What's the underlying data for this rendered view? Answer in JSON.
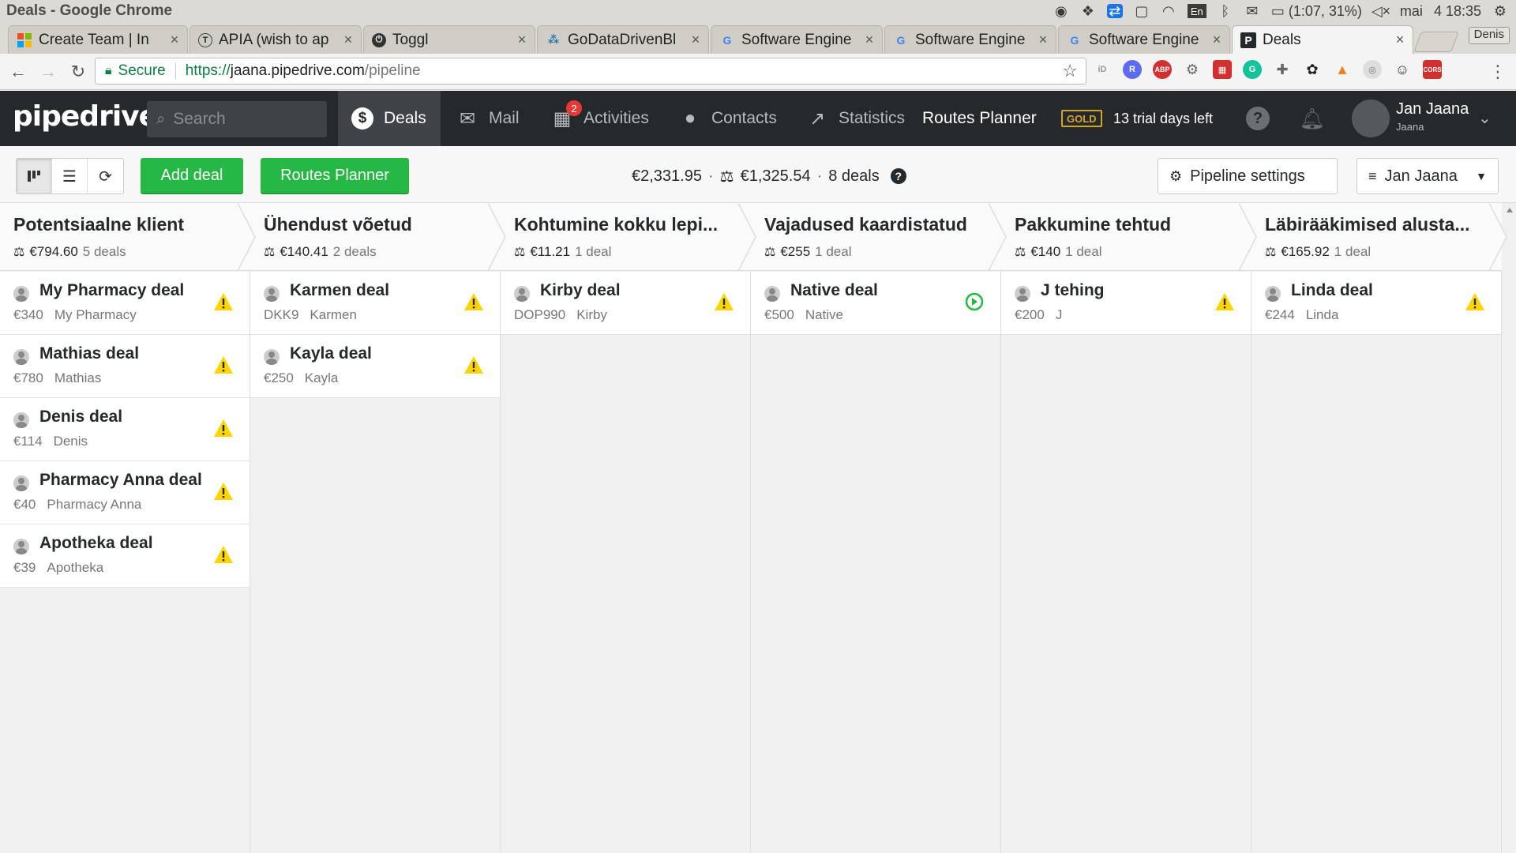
{
  "os": {
    "window_title": "Deals - Google Chrome",
    "battery": "(1:07, 31%)",
    "lang": "En",
    "day": "mai",
    "time": "4 18:35"
  },
  "browser": {
    "tabs": [
      {
        "label": "Create Team | In",
        "favicon": "microsoft"
      },
      {
        "label": "APIA (wish to ap",
        "favicon": "T"
      },
      {
        "label": "Toggl",
        "favicon": "toggl"
      },
      {
        "label": "GoDataDrivenBl",
        "favicon": "gdd"
      },
      {
        "label": "Software Engine",
        "favicon": "G"
      },
      {
        "label": "Software Engine",
        "favicon": "G"
      },
      {
        "label": "Software Engine",
        "favicon": "G"
      },
      {
        "label": "Deals",
        "favicon": "P"
      }
    ],
    "profile": "Denis",
    "secure_label": "Secure",
    "url_scheme": "https://",
    "url_host": "jaana.pipedrive.com",
    "url_path": "/pipeline"
  },
  "nav": {
    "logo": "pipedrive",
    "search_placeholder": "Search",
    "items": [
      {
        "label": "Deals"
      },
      {
        "label": "Mail"
      },
      {
        "label": "Activities",
        "badge": "2"
      },
      {
        "label": "Contacts"
      },
      {
        "label": "Statistics"
      },
      {
        "label": "Routes Planner"
      }
    ],
    "gold": "GOLD",
    "trial": "13 trial days left",
    "user_name": "Jan Jaana",
    "user_sub": "Jaana"
  },
  "toolbar": {
    "add_deal": "Add deal",
    "routes_planner": "Routes Planner",
    "total": "€2,331.95",
    "weighted": "€1,325.54",
    "deals_count": "8 deals",
    "pipeline_settings": "Pipeline settings",
    "filter_user": "Jan Jaana"
  },
  "stages": [
    {
      "title": "Potentsiaalne klient",
      "value": "€794.60",
      "count": "5 deals",
      "deals": [
        {
          "title": "My Pharmacy deal",
          "value": "€340",
          "org": "My Pharmacy",
          "status": "warning"
        },
        {
          "title": "Mathias deal",
          "value": "€780",
          "org": "Mathias",
          "status": "warning"
        },
        {
          "title": "Denis deal",
          "value": "€114",
          "org": "Denis",
          "status": "warning"
        },
        {
          "title": "Pharmacy Anna deal",
          "value": "€40",
          "org": "Pharmacy Anna",
          "status": "warning"
        },
        {
          "title": "Apotheka deal",
          "value": "€39",
          "org": "Apotheka",
          "status": "warning"
        }
      ]
    },
    {
      "title": "Ühendust võetud",
      "value": "€140.41",
      "count": "2 deals",
      "deals": [
        {
          "title": "Karmen deal",
          "value": "DKK9",
          "org": "Karmen",
          "status": "warning"
        },
        {
          "title": "Kayla deal",
          "value": "€250",
          "org": "Kayla",
          "status": "warning"
        }
      ]
    },
    {
      "title": "Kohtumine kokku lepi...",
      "value": "€11.21",
      "count": "1 deal",
      "deals": [
        {
          "title": "Kirby deal",
          "value": "DOP990",
          "org": "Kirby",
          "status": "warning"
        }
      ]
    },
    {
      "title": "Vajadused kaardistatud",
      "value": "€255",
      "count": "1 deal",
      "deals": [
        {
          "title": "Native deal",
          "value": "€500",
          "org": "Native",
          "status": "next"
        }
      ]
    },
    {
      "title": "Pakkumine tehtud",
      "value": "€140",
      "count": "1 deal",
      "deals": [
        {
          "title": "J tehing",
          "value": "€200",
          "org": "J",
          "status": "warning"
        }
      ]
    },
    {
      "title": "Läbirääkimised alusta...",
      "value": "€165.92",
      "count": "1 deal",
      "deals": [
        {
          "title": "Linda deal",
          "value": "€244",
          "org": "Linda",
          "status": "warning"
        }
      ]
    }
  ],
  "colors": {
    "nav_bg": "#26292c",
    "accent_green": "#25b845",
    "warning_yellow": "#ffd400",
    "ok_green": "#25b845"
  }
}
